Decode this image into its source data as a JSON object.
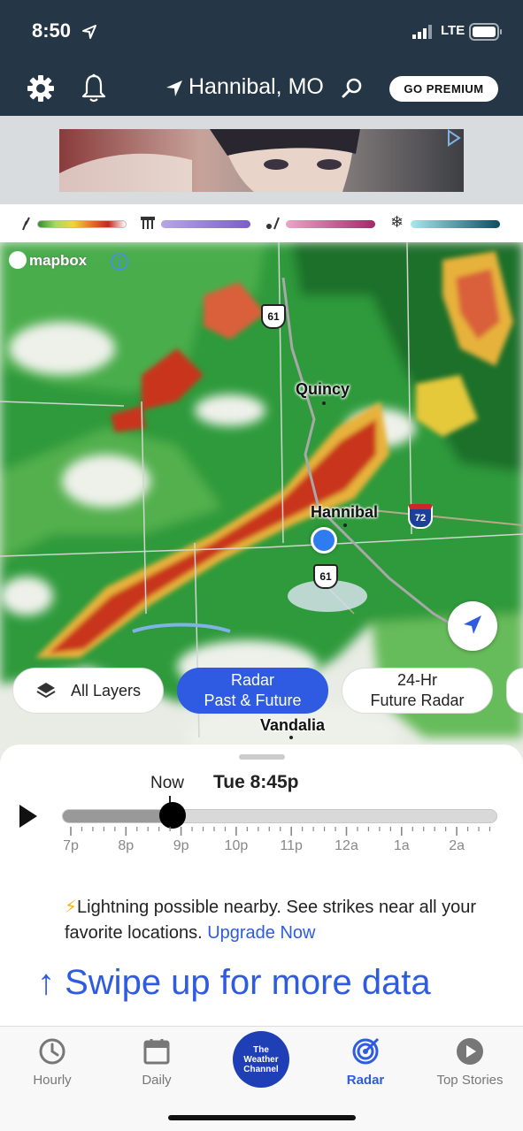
{
  "status": {
    "time": "8:50",
    "network": "LTE"
  },
  "header": {
    "location": "Hannibal, MO",
    "premium_label": "GO PREMIUM"
  },
  "map": {
    "attribution": "mapbox",
    "cities": [
      {
        "id": "quincy",
        "name": "Quincy"
      },
      {
        "id": "hannibal",
        "name": "Hannibal"
      },
      {
        "id": "vandalia",
        "name": "Vandalia"
      }
    ],
    "shields": {
      "us61_north": "61",
      "us61_south": "61",
      "i72": "72"
    }
  },
  "layers": {
    "all_layers": "All Layers",
    "radar_line1": "Radar",
    "radar_line2": "Past & Future",
    "future_line1": "24-Hr",
    "future_line2": "Future Radar"
  },
  "timeline": {
    "now_label": "Now",
    "current_time": "Tue 8:45p",
    "progress": 0.255,
    "hour_labels": [
      "7p",
      "8p",
      "9p",
      "10p",
      "11p",
      "12a",
      "1a",
      "2a"
    ]
  },
  "alert": {
    "text": "Lightning possible nearby. See strikes near all your favorite locations.",
    "link": "Upgrade Now"
  },
  "swipe_text": "↑ Swipe up for more data",
  "tabs": [
    {
      "id": "hourly",
      "label": "Hourly"
    },
    {
      "id": "daily",
      "label": "Daily"
    },
    {
      "id": "home",
      "label": "The Weather Channel"
    },
    {
      "id": "radar",
      "label": "Radar"
    },
    {
      "id": "top-stories",
      "label": "Top Stories"
    }
  ],
  "colors": {
    "header_bg": "#253746",
    "accent": "#2e5be1",
    "twc_blue": "#1e3fb5"
  }
}
